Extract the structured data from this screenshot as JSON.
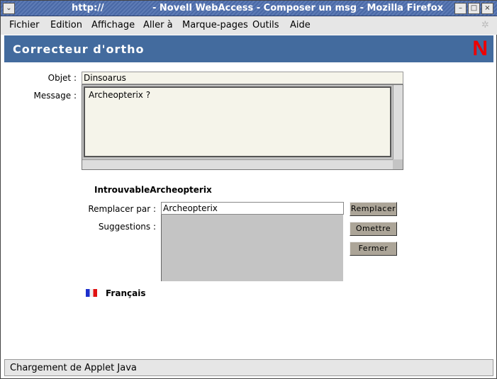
{
  "window": {
    "url": "http://",
    "title": "- Novell WebAccess - Composer un msg - Mozilla Firefox"
  },
  "menu": [
    "Fichier",
    "Edition",
    "Affichage",
    "Aller à",
    "Marque-pages",
    "Outils",
    "Aide"
  ],
  "header": {
    "title": "Correcteur d'ortho",
    "logo": "N"
  },
  "form": {
    "subject_label": "Objet :",
    "subject_value": "Dinsoarus",
    "message_label": "Message :",
    "message_value": "Archeopterix ?"
  },
  "spell": {
    "not_found": "IntrouvableArcheopterix",
    "replace_label": "Remplacer par :",
    "replace_value": "Archeopterix",
    "suggestions_label": "Suggestions :",
    "suggestions": [],
    "buttons": {
      "replace": "Remplacer",
      "skip": "Omettre",
      "close": "Fermer"
    },
    "language": "Français"
  },
  "status": "Chargement de Applet Java"
}
